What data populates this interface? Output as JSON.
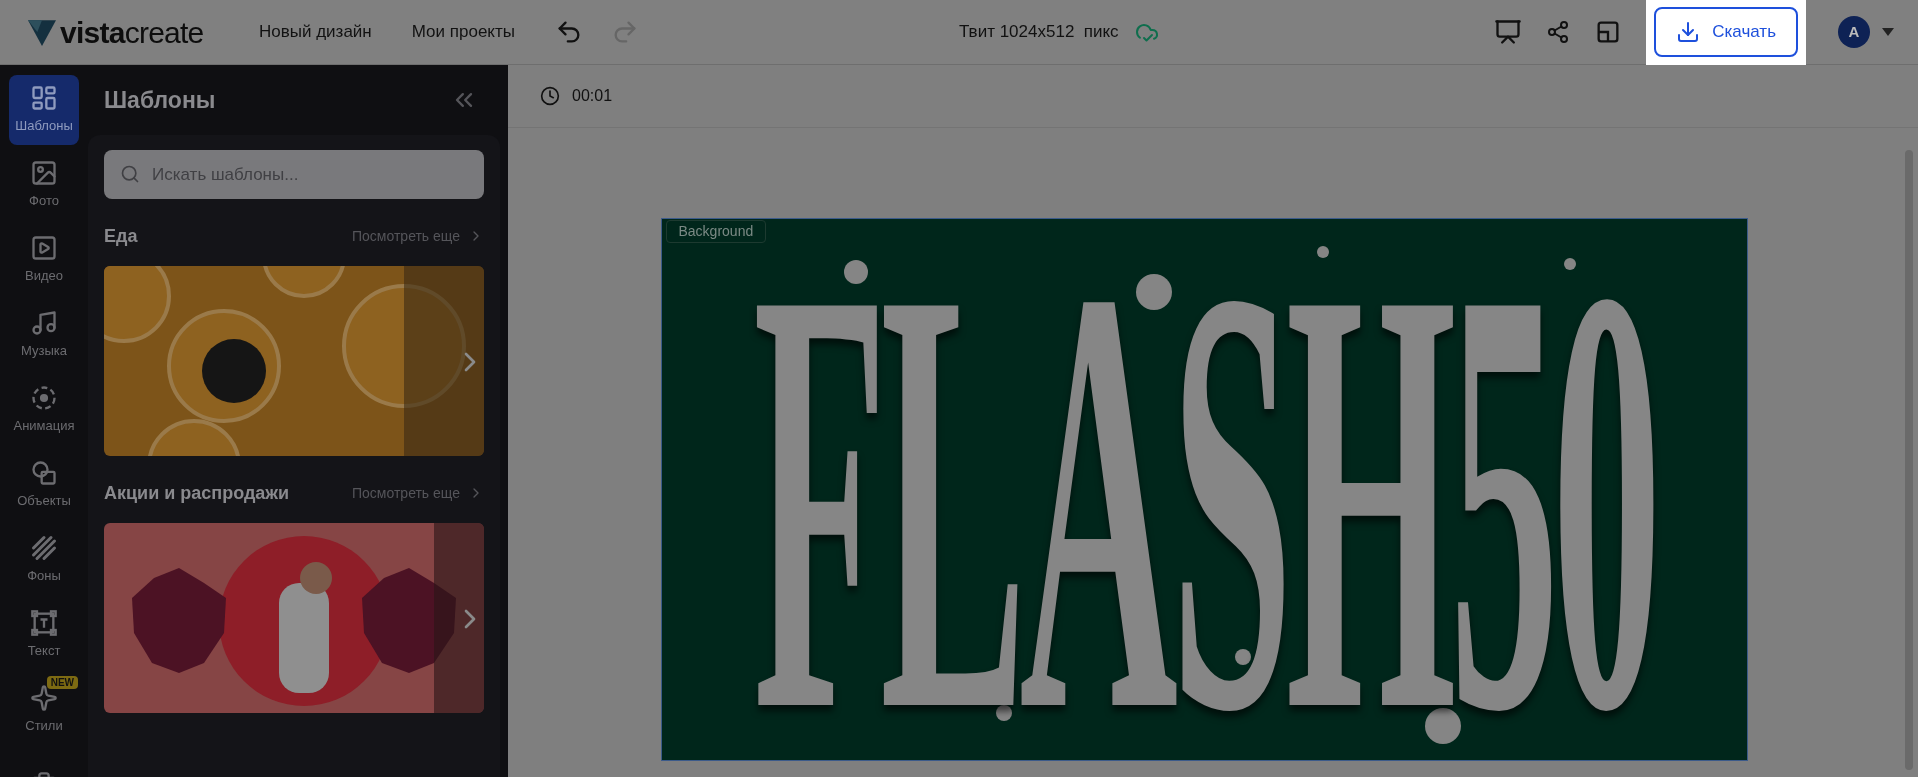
{
  "topbar": {
    "logo": "**vista**create",
    "nav": [
      "Новый дизайн",
      "Мои проекты"
    ],
    "undo": {
      "disabled": false
    },
    "redo": {
      "disabled": true
    },
    "document_title": "Твит 1024x512  пикс",
    "saved": true,
    "download_button": "Скачать",
    "avatar": "A"
  },
  "sidebar": {
    "items": [
      {
        "label": "Шаблоны",
        "selected": true
      },
      {
        "label": "Фото",
        "selected": false
      },
      {
        "label": "Видео",
        "selected": false
      },
      {
        "label": "Музыка",
        "selected": false
      },
      {
        "label": "Анимация",
        "selected": false
      },
      {
        "label": "Объекты",
        "selected": false
      },
      {
        "label": "Фоны",
        "selected": false
      },
      {
        "label": "Текст",
        "selected": false
      },
      {
        "label": "Стили",
        "selected": false,
        "badge": "NEW"
      },
      {
        "selected": false
      }
    ]
  },
  "panel": {
    "title": "Шаблоны",
    "search": {
      "placeholder": "Искать шаблоны..."
    },
    "sections": [
      {
        "title": "Еда",
        "more": "Посмотреть еще"
      },
      {
        "title": "Акции и распродажи",
        "more": "Посмотреть еще"
      }
    ]
  },
  "timeline": {
    "time": "00:01"
  },
  "canvas": {
    "layer_label": "Background",
    "headline": "FLASH50"
  }
}
